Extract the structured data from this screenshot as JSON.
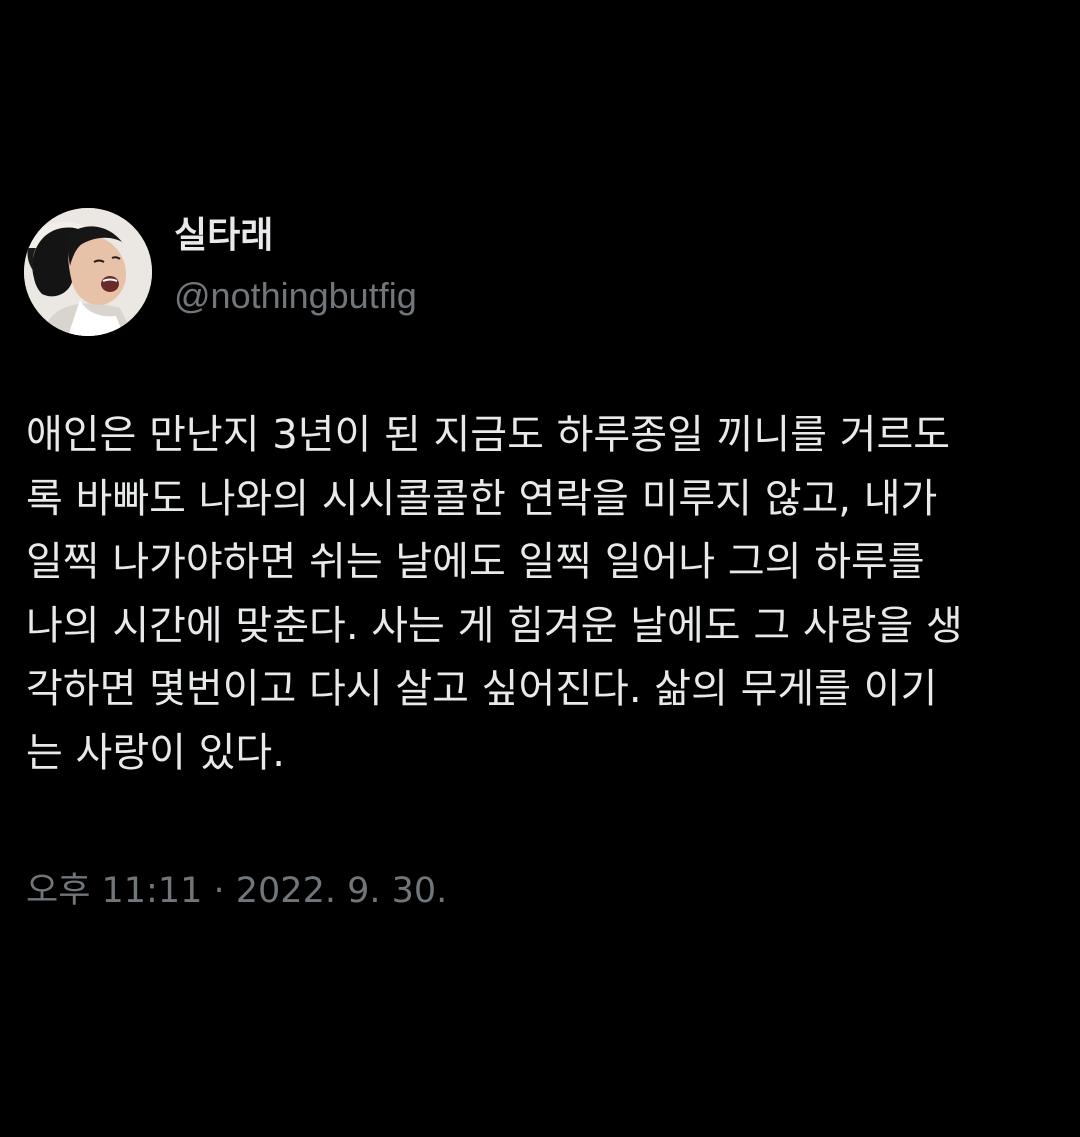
{
  "tweet": {
    "author": {
      "display_name": "실타래",
      "handle": "@nothingbutfig",
      "avatar_icon": "profile-photo"
    },
    "text_lines": [
      "애인은 만난지 3년이 된 지금도 하루종일 끼니를 거르도",
      "록 바빠도 나와의 시시콜콜한 연락을 미루지 않고, 내가",
      "일찍 나가야하면 쉬는 날에도 일찍 일어나 그의 하루를",
      "나의 시간에 맞춘다. 사는 게 힘겨운 날에도 그 사랑을 생",
      "각하면 몇번이고 다시 살고 싶어진다. 삶의 무게를 이기",
      "는 사랑이 있다."
    ],
    "timestamp": "오후 11:11 · 2022. 9. 30."
  },
  "colors": {
    "background": "#000000",
    "primary_text": "#e7e9ea",
    "secondary_text": "#71767b"
  }
}
